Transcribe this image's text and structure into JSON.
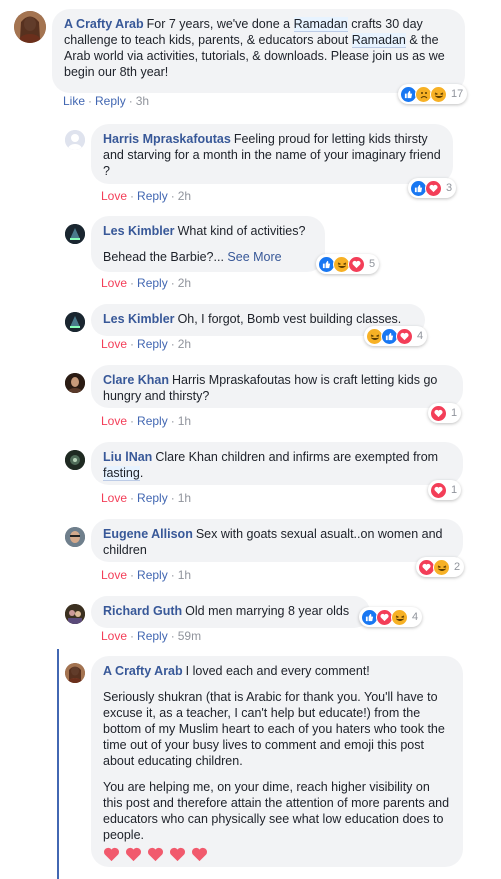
{
  "comments": [
    {
      "author": "A Crafty Arab",
      "text_1": "For 7 years, we've done a ",
      "hl_1": "Ramadan",
      "text_2": " crafts 30 day challenge to teach kids, parents, & educators about ",
      "hl_2": "Ramadan",
      "text_3": " & the Arab world via activities, tutorials, & downloads. Please join us as we begin our 8th year!",
      "action_1": "Like",
      "action_2": "Reply",
      "time": "3h",
      "reaction_count": "17"
    },
    {
      "author": "Harris Mpraskafoutas",
      "text": "Feeling proud for letting kids thirsty and starving for a month in the name of your imaginary friend ?",
      "action_1": "Love",
      "action_2": "Reply",
      "time": "2h",
      "reaction_count": "3"
    },
    {
      "author": "Les Kimbler",
      "text": "What kind of activities?",
      "text_2": "Behead the Barbie?...",
      "see_more": "See More",
      "action_1": "Love",
      "action_2": "Reply",
      "time": "2h",
      "reaction_count": "5"
    },
    {
      "author": "Les Kimbler",
      "text": "Oh, I forgot, Bomb vest building classes.",
      "action_1": "Love",
      "action_2": "Reply",
      "time": "2h",
      "reaction_count": "4"
    },
    {
      "author": "Clare Khan",
      "text": "Harris Mpraskafoutas how is craft letting kids go hungry and thirsty?",
      "action_1": "Love",
      "action_2": "Reply",
      "time": "1h",
      "reaction_count": "1"
    },
    {
      "author": "Liu lNan",
      "text": "Clare Khan children and infirms are exempted from ",
      "hl": "fasting",
      "text_after": ".",
      "action_1": "Love",
      "action_2": "Reply",
      "time": "1h",
      "reaction_count": "1"
    },
    {
      "author": "Eugene Allison",
      "text": "Sex with goats sexual asualt..on women and children",
      "action_1": "Love",
      "action_2": "Reply",
      "time": "1h",
      "reaction_count": "2"
    },
    {
      "author": "Richard Guth",
      "text": "Old men marrying 8 year olds",
      "action_1": "Love",
      "action_2": "Reply",
      "time": "59m",
      "reaction_count": "4"
    },
    {
      "author": "A Crafty Arab",
      "text": "I loved each and every comment!",
      "para_2": "Seriously shukran (that is Arabic for thank you. You'll have to excuse it, as a teacher, I can't help but educate!) from the bottom of my Muslim heart to each of you haters who took the time out of your busy lives to comment and emoji this post about educating children.",
      "para_3": "You are helping me, on your dime, reach higher visibility on this post and therefore attain the attention of more parents and educators who can physically see what low education does to people."
    }
  ],
  "colors": {
    "link": "#385898",
    "love": "#f33e58",
    "like": "#1877f2",
    "haha": "#f7b125",
    "bubble": "#f2f3f5",
    "meta": "#90949c"
  }
}
